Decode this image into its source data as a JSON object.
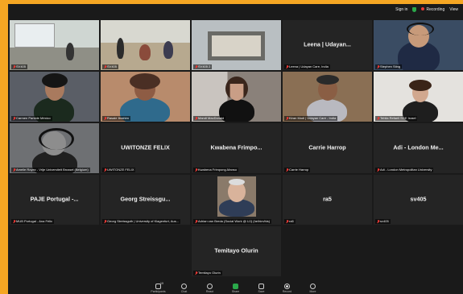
{
  "topbar": {
    "signin": "Sign in",
    "recording": "Recording",
    "view": "View"
  },
  "colors": {
    "accent": "#2ecc40",
    "mic_off": "#e53935",
    "frame": "#f5a623"
  },
  "tiles": [
    {
      "label": "SV405",
      "big": "",
      "scene": "classroom1"
    },
    {
      "label": "SV405",
      "big": "",
      "scene": "classroom2"
    },
    {
      "label": "SV405 2",
      "big": "",
      "scene": "classroom3"
    },
    {
      "label": "Leena | Udayan Care, India",
      "big": "Leena | Udayan...",
      "scene": ""
    },
    {
      "label": "Stephen Sting",
      "big": "",
      "scene": "man-headset"
    },
    {
      "label": "Carmen Parkide México",
      "big": "",
      "scene": "woman-dark"
    },
    {
      "label": "Rasaie Ibrahim",
      "big": "",
      "scene": "woman-glasses"
    },
    {
      "label": "Mandi MacDonald",
      "big": "",
      "scene": "woman-window"
    },
    {
      "label": "Kiran Modi | Udayan Care - India",
      "big": "",
      "scene": "woman-elder"
    },
    {
      "label": "Tehila Refaeli SGE Israel",
      "big": "",
      "scene": "woman-bright"
    },
    {
      "label": "Amelie Royez - Vrije Universiteit Brussel (Belgium)",
      "big": "",
      "scene": "headphones"
    },
    {
      "label": "UWITONZE FELIX",
      "big": "UWITONZE FELIX",
      "scene": ""
    },
    {
      "label": "Kwabena Frimpong-Manso",
      "big": "Kwabena Frimpo...",
      "scene": ""
    },
    {
      "label": "Carrie Harrop",
      "big": "Carrie Harrop",
      "scene": ""
    },
    {
      "label": "Adi - London Metropolitan University",
      "big": "Adi - London Me...",
      "scene": ""
    },
    {
      "label": "MUB Portugal - Ana Félix",
      "big": "PAJE Portugal -...",
      "scene": ""
    },
    {
      "label": "Georg Streissguth | University of Klagenfurt, Aus...",
      "big": "Georg Streissgu...",
      "scene": ""
    },
    {
      "label": "Adrian van Breda (Social Work @ UJ) (he/him/his)",
      "big": "",
      "scene": "portrait"
    },
    {
      "label": "ra5",
      "big": "ra5",
      "scene": ""
    },
    {
      "label": "sv405",
      "big": "sv405",
      "scene": ""
    },
    {
      "label": "Temitayo Olurin",
      "big": "Temitayo Olurin",
      "scene": ""
    }
  ],
  "toolbar": {
    "participants_count": "19",
    "items": [
      "Participants",
      "Chat",
      "React",
      "Share",
      "Save",
      "Record",
      "More"
    ]
  }
}
